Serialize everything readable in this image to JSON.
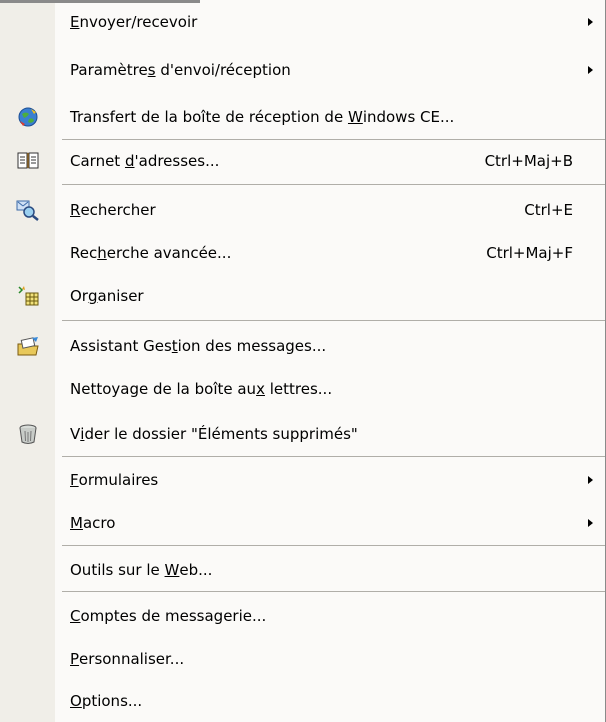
{
  "menu": {
    "items": [
      {
        "id": "envoyer-recevoir",
        "pre": "",
        "key": "E",
        "post": "nvoyer/recevoir",
        "shortcut": "",
        "submenu": true,
        "icon": ""
      },
      {
        "id": "parametres-envoi",
        "pre": "Paramètre",
        "key": "s",
        "post": " d'envoi/réception",
        "shortcut": "",
        "submenu": true,
        "icon": ""
      },
      {
        "id": "transfert-windows-ce",
        "pre": "Transfert de la boîte de réception de ",
        "key": "W",
        "post": "indows CE...",
        "shortcut": "",
        "submenu": false,
        "icon": "sync-globe-icon"
      },
      {
        "id": "carnet-adresses",
        "pre": "Carnet ",
        "key": "d",
        "post": "'adresses...",
        "shortcut": "Ctrl+Maj+B",
        "submenu": false,
        "icon": "address-book-icon"
      },
      {
        "id": "rechercher",
        "pre": "",
        "key": "R",
        "post": "echercher",
        "shortcut": "Ctrl+E",
        "submenu": false,
        "icon": "find-icon"
      },
      {
        "id": "recherche-avancee",
        "pre": "Rec",
        "key": "h",
        "post": "erche avancée...",
        "shortcut": "Ctrl+Maj+F",
        "submenu": false,
        "icon": ""
      },
      {
        "id": "organiser",
        "pre": "Or",
        "key": "g",
        "post": "aniser",
        "shortcut": "",
        "submenu": false,
        "icon": "organize-icon"
      },
      {
        "id": "assistant-gestion",
        "pre": "Assistant Ges",
        "key": "t",
        "post": "ion des messages...",
        "shortcut": "",
        "submenu": false,
        "icon": "rules-wizard-icon"
      },
      {
        "id": "nettoyage-boite",
        "pre": "Nettoyage de la boîte au",
        "key": "x",
        "post": " lettres...",
        "shortcut": "",
        "submenu": false,
        "icon": ""
      },
      {
        "id": "vider-supprimes",
        "pre": "V",
        "key": "i",
        "post": "der le dossier \"Éléments supprimés\"",
        "shortcut": "",
        "submenu": false,
        "icon": "trash-can-icon"
      },
      {
        "id": "formulaires",
        "pre": "",
        "key": "F",
        "post": "ormulaires",
        "shortcut": "",
        "submenu": true,
        "icon": ""
      },
      {
        "id": "macro",
        "pre": "",
        "key": "M",
        "post": "acro",
        "shortcut": "",
        "submenu": true,
        "icon": ""
      },
      {
        "id": "outils-web",
        "pre": "Outils sur le ",
        "key": "W",
        "post": "eb...",
        "shortcut": "",
        "submenu": false,
        "icon": ""
      },
      {
        "id": "comptes-messagerie",
        "pre": "",
        "key": "C",
        "post": "omptes de messagerie...",
        "shortcut": "",
        "submenu": false,
        "icon": ""
      },
      {
        "id": "personnaliser",
        "pre": "",
        "key": "P",
        "post": "ersonnaliser...",
        "shortcut": "",
        "submenu": false,
        "icon": ""
      },
      {
        "id": "options",
        "pre": "",
        "key": "O",
        "post": "ptions...",
        "shortcut": "",
        "submenu": false,
        "icon": ""
      }
    ]
  }
}
